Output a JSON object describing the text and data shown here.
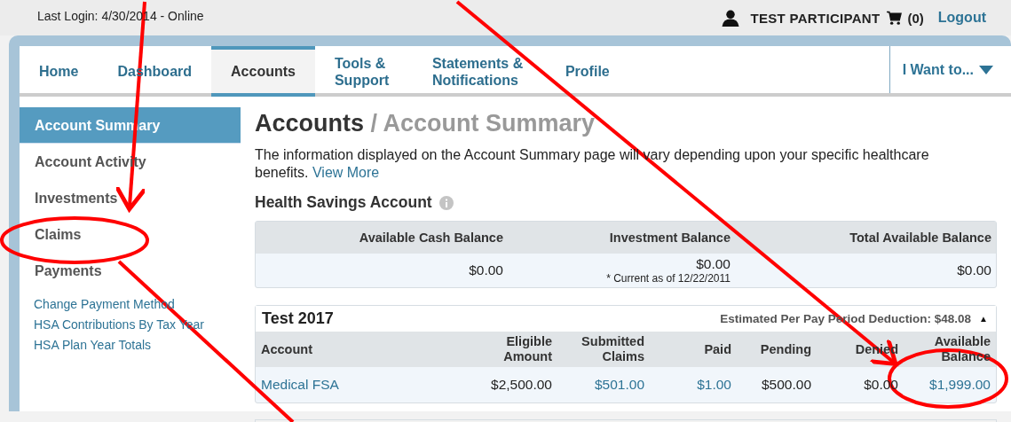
{
  "top_bar": {
    "last_login": "Last Login: 4/30/2014 - Online",
    "user": "TEST PARTICIPANT",
    "cart_count": "(0)",
    "logout": "Logout"
  },
  "nav": {
    "tabs": [
      {
        "label": "Home",
        "selected": false
      },
      {
        "label": "Dashboard",
        "selected": false
      },
      {
        "label": "Accounts",
        "selected": true
      },
      {
        "label": "Tools & Support",
        "selected": false
      },
      {
        "label": "Statements & Notifications",
        "selected": false
      },
      {
        "label": "Profile",
        "selected": false
      }
    ],
    "menu": "I Want to..."
  },
  "sidebar": {
    "items": [
      {
        "label": "Account Summary",
        "selected": true
      },
      {
        "label": "Account Activity",
        "selected": false
      },
      {
        "label": "Investments",
        "selected": false
      },
      {
        "label": "Claims",
        "selected": false
      },
      {
        "label": "Payments",
        "selected": false
      }
    ],
    "links": [
      "Change Payment Method",
      "HSA Contributions By Tax Year",
      "HSA Plan Year Totals"
    ]
  },
  "page": {
    "title": "Accounts",
    "subtitle": "/ Account Summary",
    "intro": "The information displayed on the Account Summary page will vary depending upon your specific healthcare benefits.",
    "intro_link": "View More"
  },
  "hsa": {
    "title": "Health Savings Account",
    "columns": [
      "Available Cash Balance",
      "Investment Balance",
      "Total Available Balance"
    ],
    "values": [
      "$0.00",
      "$0.00",
      "$0.00"
    ],
    "note": "* Current as of 12/22/2011"
  },
  "plan": {
    "title": "Test 2017",
    "deduction": "Estimated Per Pay Period Deduction: $48.08",
    "toggle": "▲",
    "columns": [
      "Account",
      "Eligible Amount",
      "Submitted Claims",
      "Paid",
      "Pending",
      "Denied",
      "Available Balance"
    ],
    "rows": [
      {
        "cells": [
          {
            "text": "Medical FSA",
            "link": true
          },
          {
            "text": "$2,500.00",
            "link": false
          },
          {
            "text": "$501.00",
            "link": true
          },
          {
            "text": "$1.00",
            "link": true
          },
          {
            "text": "$500.00",
            "link": false
          },
          {
            "text": "$0.00",
            "link": false
          },
          {
            "text": "$1,999.00",
            "link": true
          }
        ]
      }
    ]
  }
}
